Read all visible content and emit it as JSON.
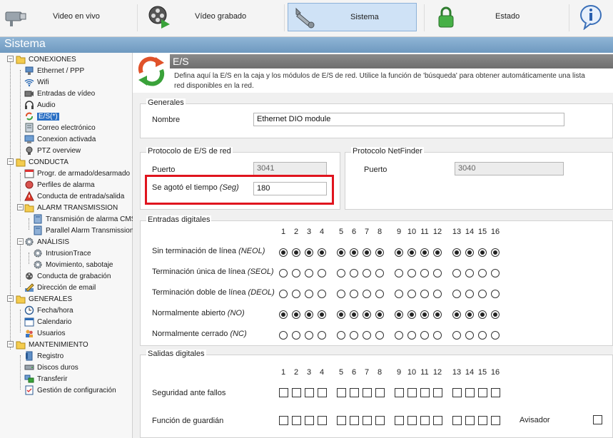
{
  "nav": {
    "live_label": "Video en vivo",
    "recorded_label": "Vídeo grabado",
    "system_label": "Sistema",
    "status_label": "Estado"
  },
  "titlebar": "Sistema",
  "sidebar": {
    "conexiones": "CONEXIONES",
    "ethernet": "Ethernet / PPP",
    "wifi": "Wifi",
    "entradas_video": "Entradas de vídeo",
    "audio": "Audio",
    "es": "E/S(*)",
    "correo": "Correo electrónico",
    "conexion_activada": "Conexion activada",
    "ptz": "PTZ overview",
    "conducta": "CONDUCTA",
    "armado": "Progr. de armado/desarmado",
    "perfiles": "Perfiles de alarma",
    "conducta_es": "Conducta de entrada/salida",
    "alarm_transmission": "ALARM TRANSMISSION",
    "cms": "Transmisión de alarma CMS",
    "parallel": "Parallel Alarm Transmission",
    "analisis": "ANÁLISIS",
    "intrusion": "IntrusionTrace",
    "movimiento": "Movimiento, sabotaje",
    "grabacion": "Conducta de grabación",
    "email": "Dirección de email",
    "generales": "GENERALES",
    "fecha": "Fecha/hora",
    "calendario": "Calendario",
    "usuarios": "Usuarios",
    "mantenimiento": "MANTENIMIENTO",
    "registro": "Registro",
    "discos": "Discos duros",
    "transferir": "Transferir",
    "gestion": "Gestión de configuración"
  },
  "page": {
    "title": "E/S",
    "desc_line1": "Defina aquí la E/S en la caja y los módulos de E/S de red. Utilice la función de 'búsqueda' para obtener automáticamente una lista",
    "desc_line2": "red disponibles en la red."
  },
  "generales": {
    "legend": "Generales",
    "name_label": "Nombre",
    "name_value": "Ethernet DIO module"
  },
  "protocolo": {
    "legend": "Protocolo de E/S de red",
    "port_label": "Puerto",
    "port_value": "3041",
    "timeout_label": "Se agotó el tiempo",
    "timeout_unit": "(Seg)",
    "timeout_value": "180"
  },
  "netfinder": {
    "legend": "Protocolo NetFinder",
    "port_label": "Puerto",
    "port_value": "3040"
  },
  "inputs": {
    "legend": "Entradas digitales",
    "channels": [
      "1",
      "2",
      "3",
      "4",
      "5",
      "6",
      "7",
      "8",
      "9",
      "10",
      "11",
      "12",
      "13",
      "14",
      "15",
      "16"
    ],
    "rows": [
      {
        "label": "Sin terminación de línea",
        "abbr": "(NEOL)",
        "selected": true
      },
      {
        "label": "Terminación única de línea",
        "abbr": "(SEOL)",
        "selected": false
      },
      {
        "label": "Terminación doble de línea",
        "abbr": "(DEOL)",
        "selected": false
      },
      {
        "label": "Normalmente abierto",
        "abbr": "(NO)",
        "selected": true
      },
      {
        "label": "Normalmente cerrado",
        "abbr": "(NC)",
        "selected": false
      }
    ]
  },
  "outputs": {
    "legend": "Salidas digitales",
    "channels": [
      "1",
      "2",
      "3",
      "4",
      "5",
      "6",
      "7",
      "8",
      "9",
      "10",
      "11",
      "12",
      "13",
      "14",
      "15",
      "16"
    ],
    "rows": [
      {
        "label": "Seguridad ante fallos"
      },
      {
        "label": "Función de guardián"
      }
    ],
    "watchdog_label": "Avisador"
  },
  "colors": {
    "selection": "#2a6fc4",
    "highlight": "#e0141e",
    "titlebar": "#7fa7cb"
  }
}
